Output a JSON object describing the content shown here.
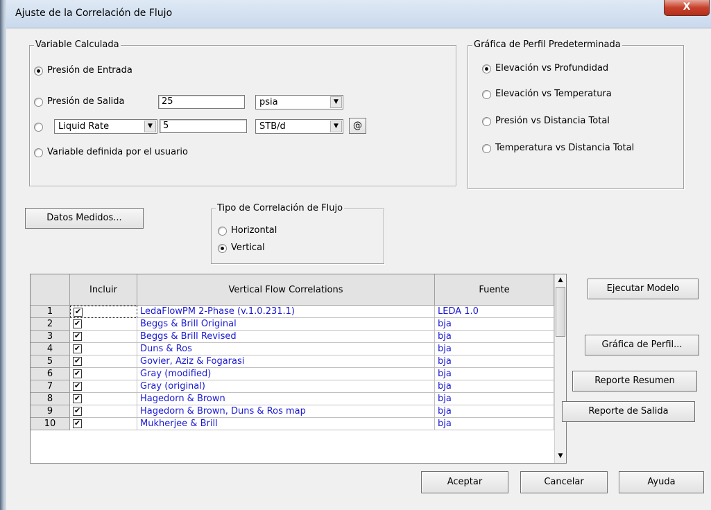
{
  "window": {
    "title": "Ajuste de la Correlación de Flujo",
    "close_glyph": "X"
  },
  "variable_calculada": {
    "legend": "Variable Calculada",
    "presion_entrada_label": "Presión de Entrada",
    "presion_salida_label": "Presión de Salida",
    "presion_salida_value": "25",
    "presion_salida_unit": "psia",
    "rate_type": "Liquid Rate",
    "rate_value": "5",
    "rate_unit": "STB/d",
    "at_button": "@",
    "user_variable_label": "Variable definida por el usuario",
    "selected": "Presión de Entrada"
  },
  "grafica_perfil": {
    "legend": "Gráfica de Perfil Predeterminada",
    "options": [
      "Elevación vs Profundidad",
      "Elevación vs Temperatura",
      "Presión vs Distancia Total",
      "Temperatura vs Distancia Total"
    ],
    "selected": "Elevación vs Profundidad"
  },
  "datos_medidos_button": "Datos Medidos...",
  "tipo_correlacion": {
    "legend": "Tipo de Correlación de Flujo",
    "options": [
      "Horizontal",
      "Vertical"
    ],
    "selected": "Vertical"
  },
  "grid": {
    "columns": [
      "",
      "Incluir",
      "Vertical Flow Correlations",
      "Fuente"
    ],
    "rows": [
      {
        "n": "1",
        "checked": true,
        "name": "LedaFlowPM 2-Phase (v.1.0.231.1)",
        "source": "LEDA 1.0"
      },
      {
        "n": "2",
        "checked": true,
        "name": "Beggs & Brill Original",
        "source": "bja"
      },
      {
        "n": "3",
        "checked": true,
        "name": "Beggs & Brill Revised",
        "source": "bja"
      },
      {
        "n": "4",
        "checked": true,
        "name": "Duns & Ros",
        "source": "bja"
      },
      {
        "n": "5",
        "checked": true,
        "name": "Govier, Aziz & Fogarasi",
        "source": "bja"
      },
      {
        "n": "6",
        "checked": true,
        "name": "Gray (modified)",
        "source": "bja"
      },
      {
        "n": "7",
        "checked": true,
        "name": "Gray (original)",
        "source": "bja"
      },
      {
        "n": "8",
        "checked": true,
        "name": "Hagedorn & Brown",
        "source": "bja"
      },
      {
        "n": "9",
        "checked": true,
        "name": "Hagedorn & Brown, Duns & Ros map",
        "source": "bja"
      },
      {
        "n": "10",
        "checked": true,
        "name": "Mukherjee & Brill",
        "source": "bja"
      }
    ]
  },
  "side_buttons": {
    "ejecutar": "Ejecutar Modelo",
    "grafica": "Gráfica de Perfil...",
    "resumen": "Reporte Resumen",
    "salida": "Reporte de Salida"
  },
  "bottom_buttons": {
    "aceptar": "Aceptar",
    "cancelar": "Cancelar",
    "ayuda": "Ayuda"
  },
  "colors": {
    "link_text": "#1a1ad6",
    "dialog_bg": "#f0f0f0",
    "close_red": "#c8402b"
  }
}
